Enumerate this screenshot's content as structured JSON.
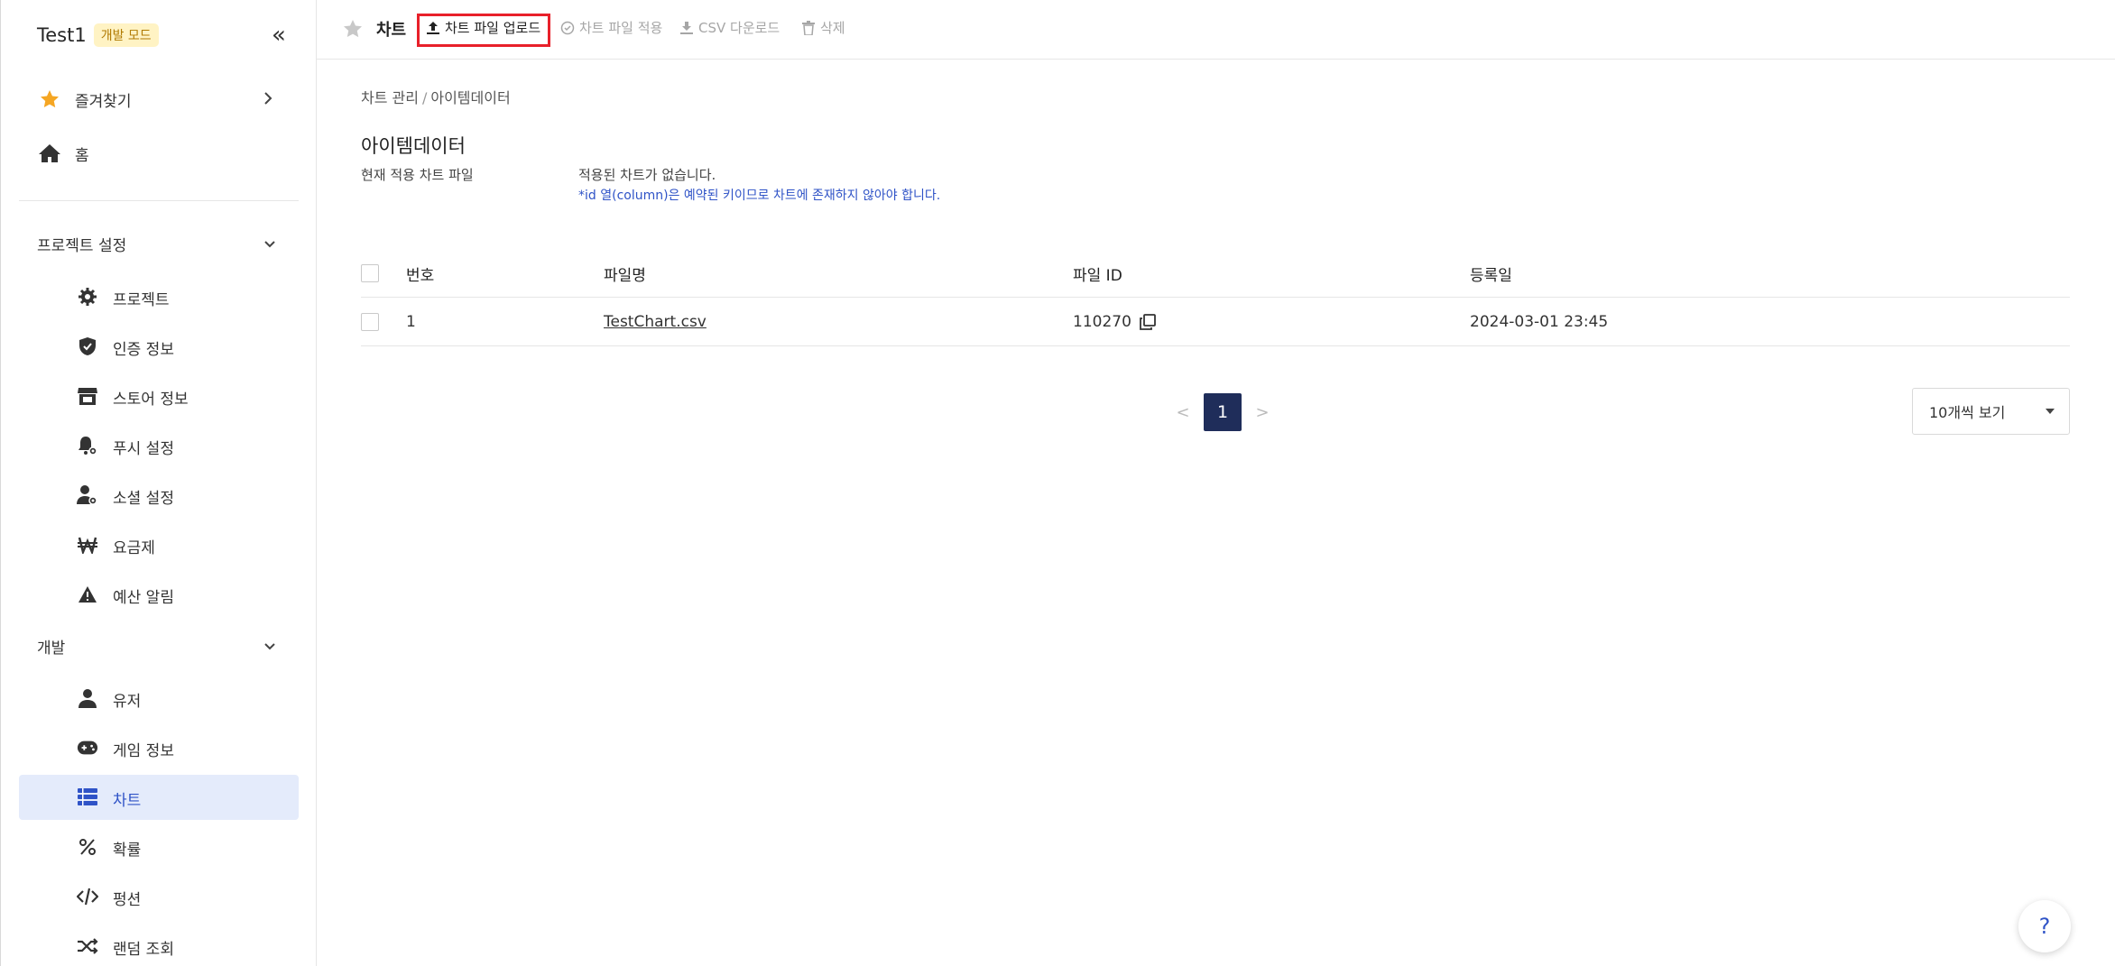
{
  "sidebar": {
    "project_name": "Test1",
    "mode_badge": "개발 모드",
    "top_items": [
      {
        "label": "즐겨찾기",
        "icon": "star-icon"
      },
      {
        "label": "홈",
        "icon": "home-icon"
      }
    ],
    "sections": [
      {
        "label": "프로젝트 설정",
        "items": [
          {
            "label": "프로젝트",
            "icon": "gear-icon"
          },
          {
            "label": "인증 정보",
            "icon": "shield-check-icon"
          },
          {
            "label": "스토어 정보",
            "icon": "store-icon"
          },
          {
            "label": "푸시 설정",
            "icon": "bell-gear-icon"
          },
          {
            "label": "소셜 설정",
            "icon": "user-gear-icon"
          },
          {
            "label": "요금제",
            "icon": "won-icon"
          },
          {
            "label": "예산 알림",
            "icon": "warning-icon"
          }
        ]
      },
      {
        "label": "개발",
        "items": [
          {
            "label": "유저",
            "icon": "user-icon"
          },
          {
            "label": "게임 정보",
            "icon": "gamepad-icon"
          },
          {
            "label": "차트",
            "icon": "table-icon",
            "active": true
          },
          {
            "label": "확률",
            "icon": "percent-icon"
          },
          {
            "label": "펑션",
            "icon": "code-icon"
          },
          {
            "label": "랜덤 조회",
            "icon": "shuffle-icon"
          }
        ]
      }
    ]
  },
  "topbar": {
    "page_name": "차트",
    "actions": [
      {
        "label": "차트 파일 업로드",
        "icon": "upload-icon",
        "enabled": true
      },
      {
        "label": "차트 파일 적용",
        "icon": "check-circle-icon",
        "enabled": false
      },
      {
        "label": "CSV 다운로드",
        "icon": "download-icon",
        "enabled": false
      },
      {
        "label": "삭제",
        "icon": "trash-icon",
        "enabled": false
      }
    ]
  },
  "breadcrumb": {
    "parent": "차트 관리",
    "separator": "/",
    "current": "아이템데이터"
  },
  "page_title": "아이템데이터",
  "current_chart": {
    "label": "현재 적용 차트 파일",
    "value": "적용된 차트가 없습니다.",
    "note": "*id 열(column)은 예약된 키이므로 차트에 존재하지 않아야 합니다."
  },
  "table": {
    "columns": [
      "번호",
      "파일명",
      "파일 ID",
      "등록일"
    ],
    "rows": [
      {
        "no": "1",
        "filename": "TestChart.csv",
        "file_id": "110270",
        "date": "2024-03-01 23:45"
      }
    ]
  },
  "pagination": {
    "prev": "<",
    "current": "1",
    "next": ">"
  },
  "page_size": {
    "selected": "10개씩 보기"
  },
  "help": {
    "label": "?"
  },
  "colors": {
    "accent": "#2f53c7",
    "active_bg": "#e4ebfb",
    "highlight": "#e8202a",
    "pager_bg": "#1f2d5a",
    "badge_bg": "#fff3c4",
    "star": "#f5a623"
  }
}
